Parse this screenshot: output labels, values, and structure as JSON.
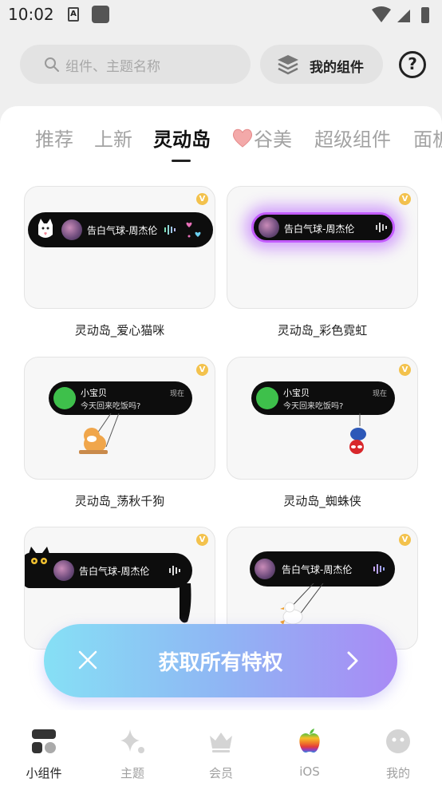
{
  "status_bar": {
    "time": "10:02",
    "notif_glyph": "A"
  },
  "search": {
    "placeholder": "组件、主题名称"
  },
  "my_widgets": {
    "label": "我的组件"
  },
  "help": {
    "glyph": "?"
  },
  "tabs": [
    {
      "label": "推荐"
    },
    {
      "label": "上新"
    },
    {
      "label": "灵动岛",
      "active": true
    },
    {
      "label": "谷美"
    },
    {
      "label": "超级组件"
    },
    {
      "label": "面板"
    }
  ],
  "cards": [
    {
      "label": "灵动岛_爱心猫咪",
      "song": "告白气球-周杰伦",
      "vip": "V"
    },
    {
      "label": "灵动岛_彩色霓虹",
      "song": "告白气球-周杰伦",
      "vip": "V"
    },
    {
      "label": "灵动岛_荡秋千狗",
      "msg_title": "小宝贝",
      "msg_body": "今天回来吃饭吗?",
      "msg_time": "现在",
      "vip": "V"
    },
    {
      "label": "灵动岛_蜘蛛侠",
      "msg_title": "小宝贝",
      "msg_body": "今天回来吃饭吗?",
      "msg_time": "现在",
      "vip": "V"
    },
    {
      "label": "",
      "song": "告白气球-周杰伦",
      "vip": "V"
    },
    {
      "label": "",
      "song": "告白气球-周杰伦",
      "vip": "V"
    }
  ],
  "cta": {
    "label": "获取所有特权"
  },
  "bottom_nav": [
    {
      "label": "小组件",
      "active": true
    },
    {
      "label": "主题"
    },
    {
      "label": "会员"
    },
    {
      "label": "iOS"
    },
    {
      "label": "我的"
    }
  ],
  "colors": {
    "cta_start": "#86e0f5",
    "cta_end": "#a98af5",
    "vip": "#f3c24d",
    "wechat": "#3ec04b",
    "neon": "#a336ff"
  }
}
